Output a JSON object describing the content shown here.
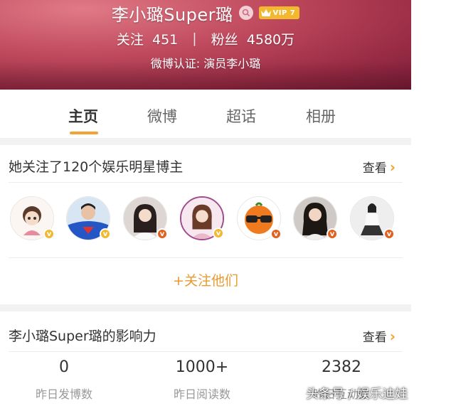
{
  "profile": {
    "name": "李小璐Super璐",
    "vip_label": "VIP 7",
    "follow_label": "关注",
    "follow_count": "451",
    "separator": "|",
    "fans_label": "粉丝",
    "fans_count": "4580万",
    "verification": "微博认证: 演员李小璐"
  },
  "tabs": [
    "主页",
    "微博",
    "超话",
    "相册"
  ],
  "following": {
    "title": "她关注了120个娱乐明星博主",
    "more_label": "查看",
    "follow_all_label": "+关注他们",
    "avatars": [
      {
        "name": "avatar-cartoon-girl",
        "badge_color": "#f2b930"
      },
      {
        "name": "avatar-man-blue-shirt",
        "badge_color": "#f2b930"
      },
      {
        "name": "avatar-woman-white-dress",
        "badge_color": "#e2611f"
      },
      {
        "name": "avatar-woman-purple-frame",
        "badge_color": "#f2b930"
      },
      {
        "name": "avatar-orange-sunglasses",
        "badge_color": "#e2611f"
      },
      {
        "name": "avatar-woman-black-hair",
        "badge_color": "#e2611f"
      },
      {
        "name": "avatar-woman-sitting",
        "badge_color": "#e2611f"
      }
    ]
  },
  "influence": {
    "title": "李小璐Super璐的影响力",
    "more_label": "查看",
    "metrics": [
      {
        "value": "0",
        "label": "昨日发博数"
      },
      {
        "value": "1000+",
        "label": "昨日阅读数"
      },
      {
        "value": "2382",
        "label": "昨日互动数"
      }
    ]
  },
  "watermark": "头条号 / 娱乐迪娃",
  "colors": {
    "accent": "#f4a234",
    "follow_all": "#e89a2e",
    "vip": "#f2b930",
    "verified_orange": "#e2611f"
  }
}
